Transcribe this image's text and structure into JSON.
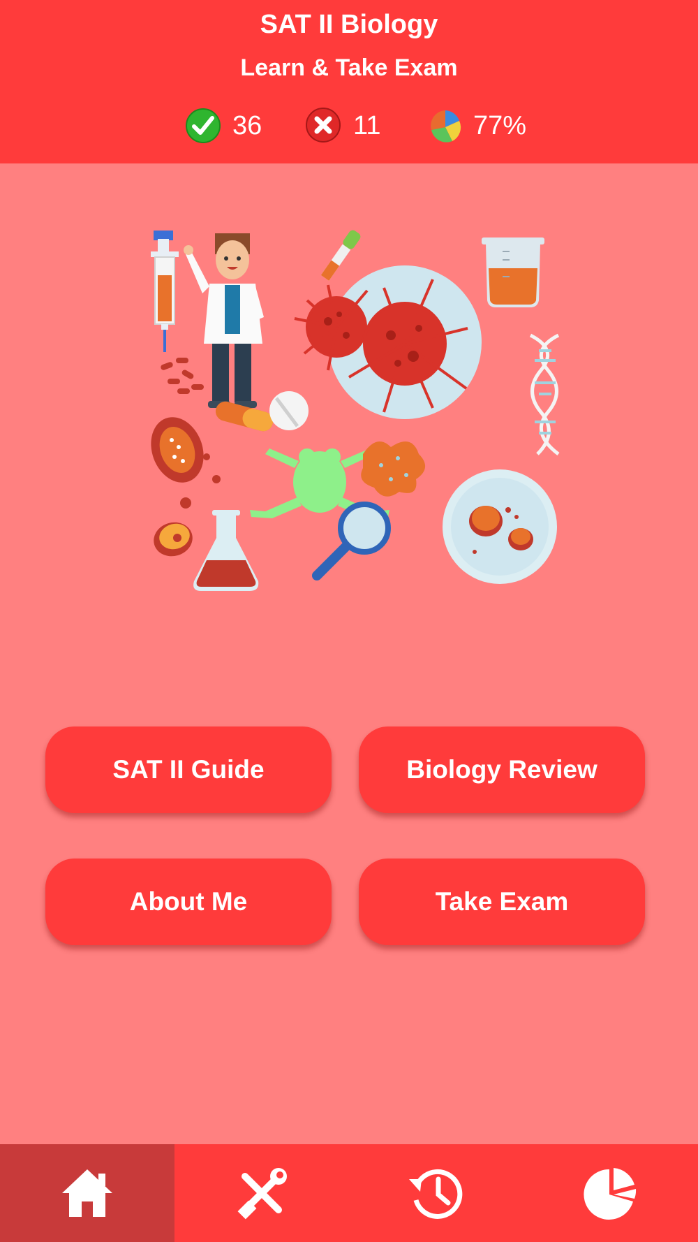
{
  "header": {
    "title": "SAT II Biology",
    "subtitle": "Learn & Take Exam",
    "stats": {
      "correct": "36",
      "wrong": "11",
      "score": "77%"
    }
  },
  "illustration": {
    "icon": "biology-illustration"
  },
  "buttons": {
    "guide": "SAT II Guide",
    "review": "Biology Review",
    "about": "About Me",
    "exam": "Take Exam"
  },
  "nav": {
    "items": [
      {
        "icon": "home-icon",
        "active": true
      },
      {
        "icon": "tools-icon",
        "active": false
      },
      {
        "icon": "history-icon",
        "active": false
      },
      {
        "icon": "pie-chart-icon",
        "active": false
      }
    ]
  },
  "colors": {
    "header": "#ff3b3b",
    "background": "#ff8080",
    "button": "#ff3b3b",
    "nav_active": "#c83a3a"
  }
}
